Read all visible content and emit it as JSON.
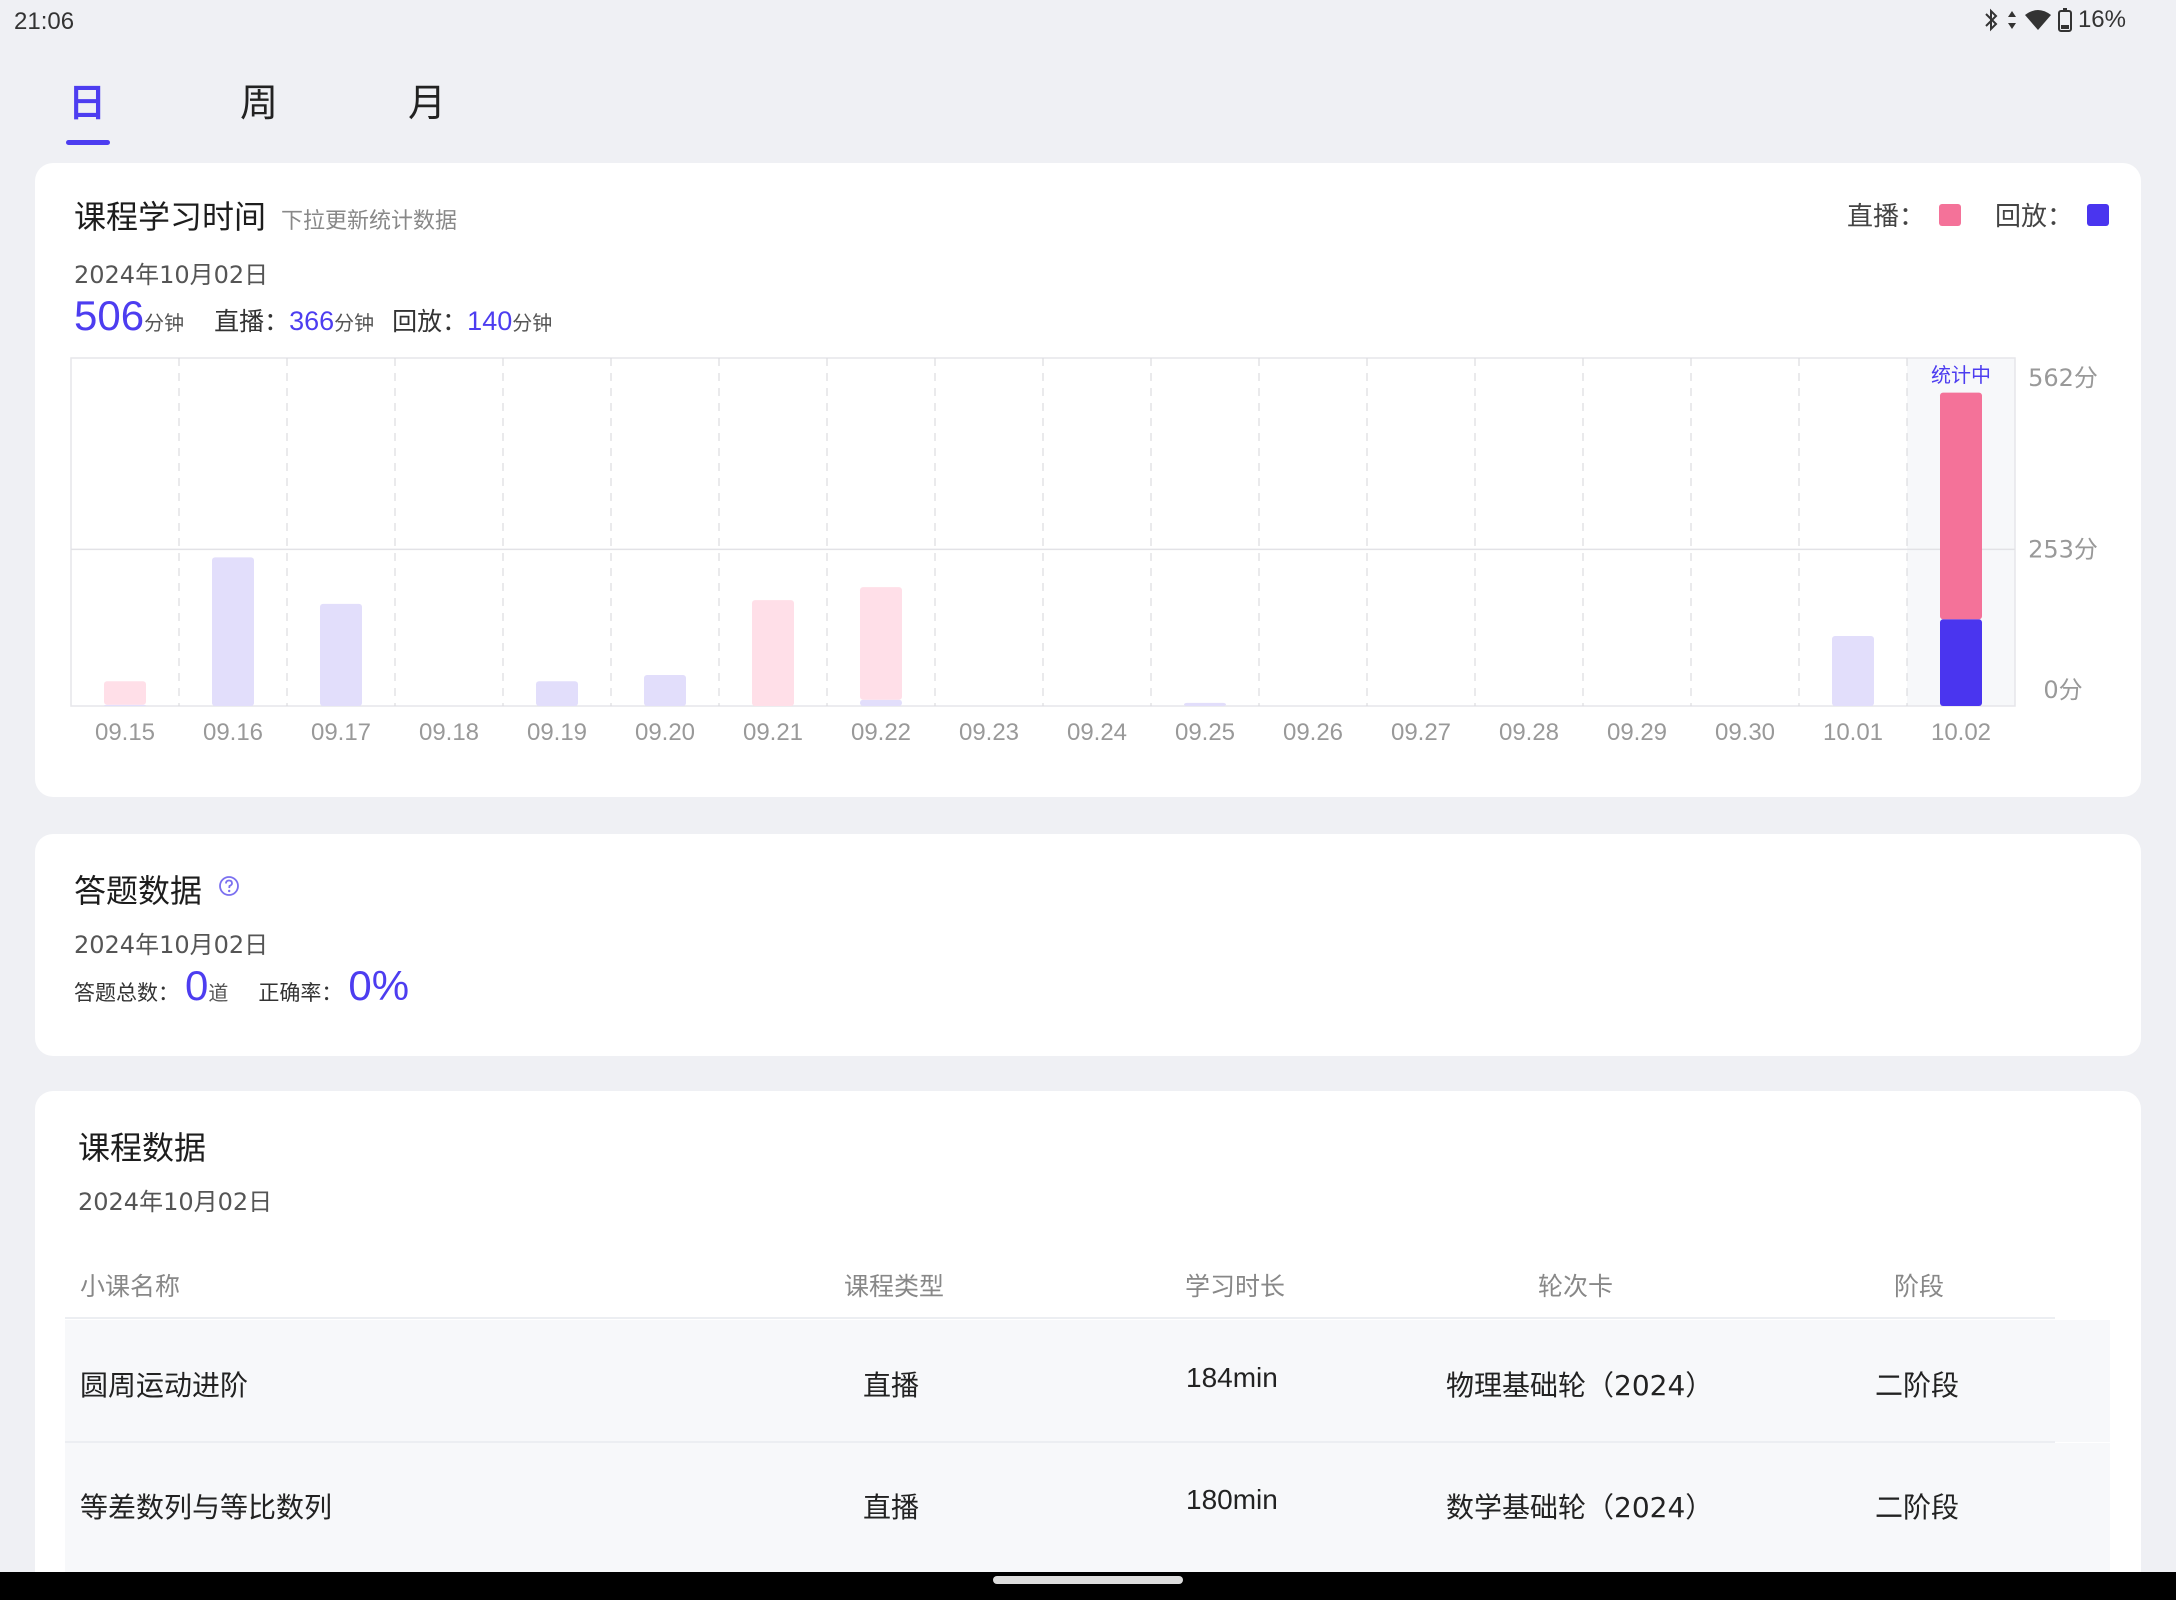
{
  "status_bar": {
    "time": "21:06",
    "battery": "16%"
  },
  "tabs": [
    {
      "label": "日",
      "active": true
    },
    {
      "label": "周",
      "active": false
    },
    {
      "label": "月",
      "active": false
    }
  ],
  "study_time": {
    "title": "课程学习时间",
    "hint": "下拉更新统计数据",
    "date": "2024年10月02日",
    "total": "506",
    "total_unit": "分钟",
    "live_label": "直播：",
    "live_value": "366",
    "live_unit": "分钟",
    "replay_label": "回放：",
    "replay_value": "140",
    "replay_unit": "分钟",
    "legend": {
      "live": "直播：",
      "replay": "回放："
    },
    "colors": {
      "live": "#f47299",
      "replay": "#4a35ef",
      "live_faded": "#ffdfe8",
      "replay_faded": "#e2defb",
      "accent": "#4d3df0"
    }
  },
  "chart_data": {
    "type": "bar",
    "stacked": true,
    "categories": [
      "09.15",
      "09.16",
      "09.17",
      "09.18",
      "09.19",
      "09.20",
      "09.21",
      "09.22",
      "09.23",
      "09.24",
      "09.25",
      "09.26",
      "09.27",
      "09.28",
      "09.29",
      "09.30",
      "10.01",
      "10.02"
    ],
    "series": [
      {
        "name": "回放",
        "values": [
          2,
          240,
          165,
          0,
          40,
          50,
          0,
          10,
          0,
          0,
          5,
          0,
          0,
          0,
          0,
          0,
          113,
          140
        ]
      },
      {
        "name": "直播",
        "values": [
          38,
          0,
          0,
          0,
          0,
          0,
          171,
          182,
          0,
          0,
          0,
          0,
          0,
          0,
          0,
          0,
          0,
          366
        ]
      }
    ],
    "y_ticks": [
      "562分",
      "253分",
      "0分"
    ],
    "ylim": [
      0,
      562
    ],
    "highlight_label": "统计中",
    "highlight_index": 17
  },
  "answers": {
    "title": "答题数据",
    "date": "2024年10月02日",
    "total_label": "答题总数：",
    "total_value": "0",
    "total_unit": "道",
    "accuracy_label": "正确率：",
    "accuracy_value": "0%"
  },
  "courses": {
    "title": "课程数据",
    "date": "2024年10月02日",
    "headers": [
      "小课名称",
      "课程类型",
      "学习时长",
      "轮次卡",
      "阶段"
    ],
    "rows": [
      [
        "圆周运动进阶",
        "直播",
        "184min",
        "物理基础轮（2024）",
        "二阶段"
      ],
      [
        "等差数列与等比数列",
        "直播",
        "180min",
        "数学基础轮（2024）",
        "二阶段"
      ]
    ]
  }
}
